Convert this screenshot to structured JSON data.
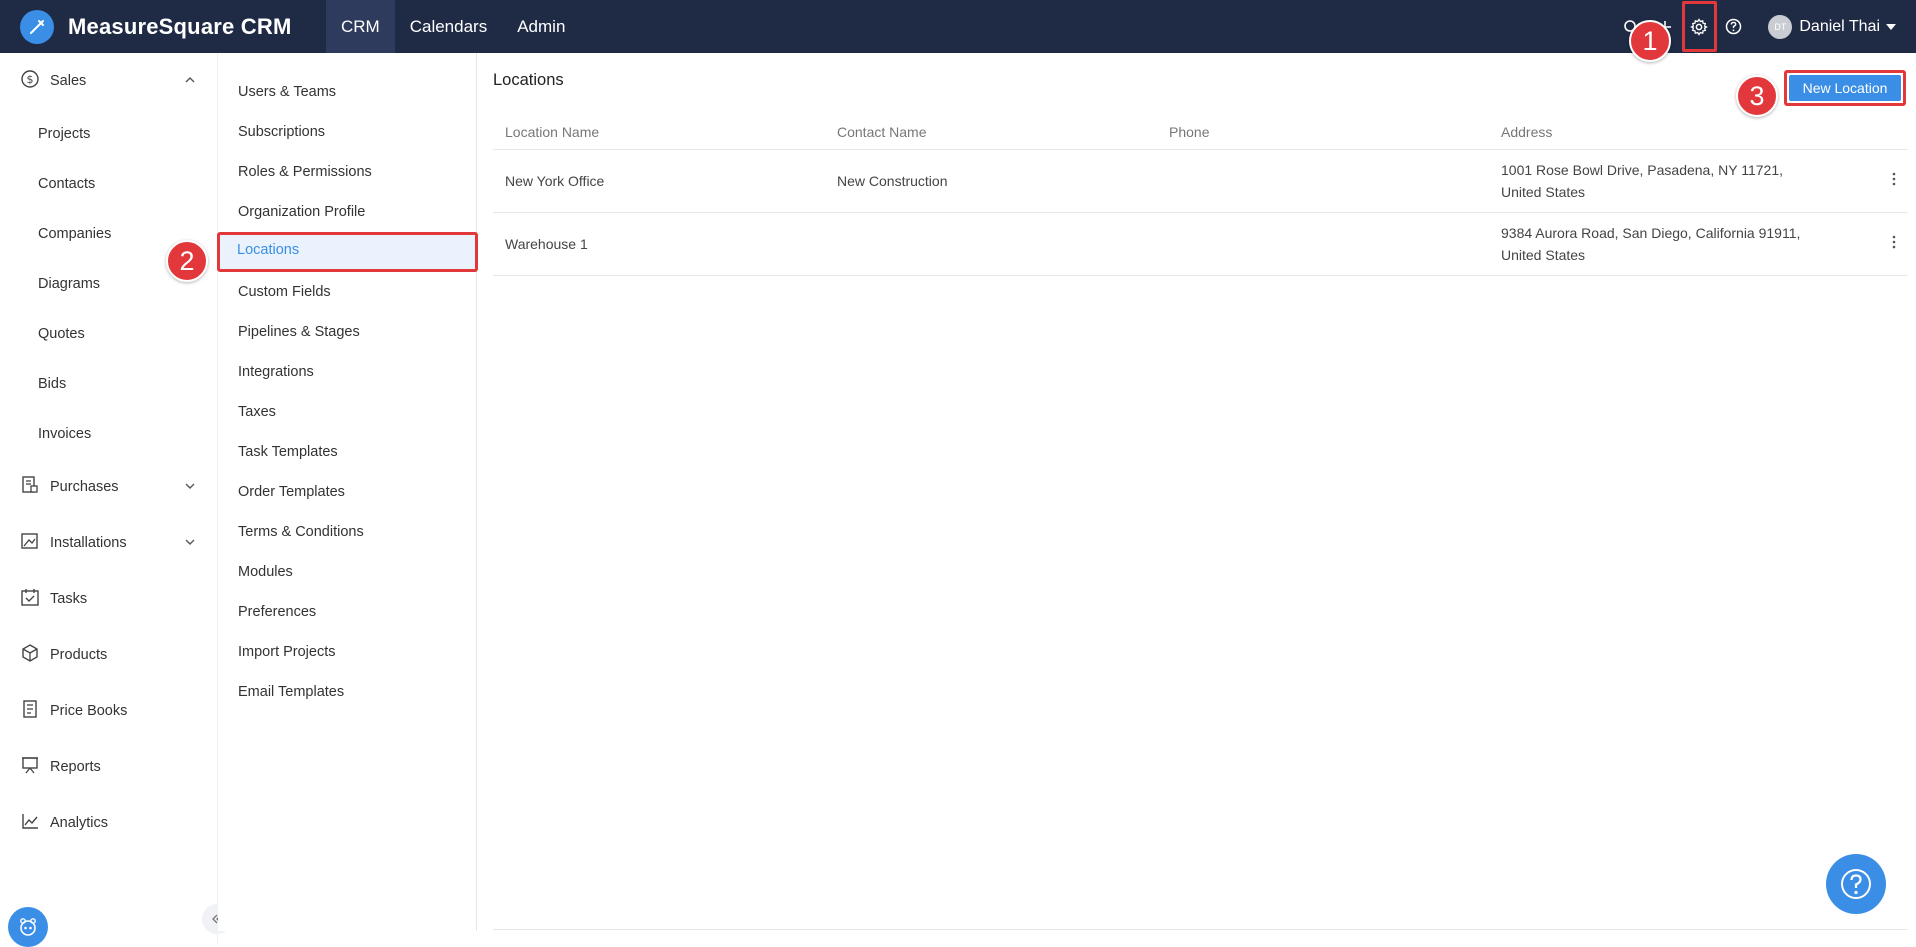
{
  "topbar": {
    "brand_name": "MeasureSquare CRM",
    "nav": [
      "CRM",
      "Calendars",
      "Admin"
    ],
    "active_nav": "CRM",
    "user_initials": "DT",
    "user_name": "Daniel Thai"
  },
  "sidebar": {
    "sections": [
      {
        "label": "Sales",
        "icon": "dollar-circle-icon",
        "expanded": true
      },
      {
        "label": "Purchases",
        "icon": "purchase-doc-icon"
      },
      {
        "label": "Installations",
        "icon": "installation-icon"
      },
      {
        "label": "Tasks",
        "icon": "calendar-check-icon"
      },
      {
        "label": "Products",
        "icon": "box-icon"
      },
      {
        "label": "Price Books",
        "icon": "book-icon"
      },
      {
        "label": "Reports",
        "icon": "presentation-icon"
      },
      {
        "label": "Analytics",
        "icon": "line-chart-icon"
      }
    ],
    "sales_items": [
      "Projects",
      "Contacts",
      "Companies",
      "Diagrams",
      "Quotes",
      "Bids",
      "Invoices"
    ]
  },
  "settings_menu": {
    "items": [
      "Users & Teams",
      "Subscriptions",
      "Roles & Permissions",
      "Organization Profile",
      "Locations",
      "Custom Fields",
      "Pipelines & Stages",
      "Integrations",
      "Taxes",
      "Task Templates",
      "Order Templates",
      "Terms & Conditions",
      "Modules",
      "Preferences",
      "Import Projects",
      "Email Templates"
    ],
    "active": "Locations"
  },
  "main": {
    "title": "Locations",
    "new_button": "New Location",
    "columns": [
      "Location Name",
      "Contact Name",
      "Phone",
      "Address"
    ],
    "rows": [
      {
        "name": "New York Office",
        "contact": "New Construction",
        "phone": "",
        "address_line1": "1001 Rose Bowl Drive, Pasadena, NY 11721,",
        "address_line2": "United States"
      },
      {
        "name": "Warehouse 1",
        "contact": "",
        "phone": "",
        "address_line1": "9384 Aurora Road, San Diego, California 91911,",
        "address_line2": "United States"
      }
    ]
  },
  "annotations": [
    "1",
    "2",
    "3"
  ],
  "colors": {
    "navbar": "#1f2a44",
    "accent": "#3a8ee6",
    "annotation": "#e2383c",
    "active_item_bg": "#e9f2fd"
  }
}
